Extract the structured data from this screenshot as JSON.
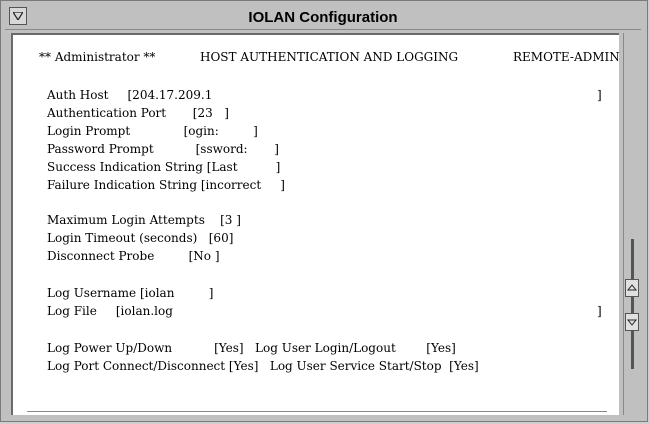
{
  "window": {
    "title": "IOLAN Configuration"
  },
  "header": {
    "left": "** Administrator **",
    "center": "HOST AUTHENTICATION AND LOGGING",
    "right": "REMOTE-ADMIN"
  },
  "fields": {
    "auth_host": "Auth Host     [204.17.209.1",
    "auth_host_end": "]",
    "auth_port": "Authentication Port       [23   ]",
    "login_prompt": "Login Prompt              [ogin:         ]",
    "password_prompt": "Password Prompt           [ssword:       ]",
    "success_string": "Success Indication String [Last          ]",
    "failure_string": "Failure Indication String [incorrect     ]",
    "max_login": "Maximum Login Attempts    [3 ]",
    "login_timeout": "Login Timeout (seconds)   [60]",
    "disconnect_probe": "Disconnect Probe         [No ]",
    "log_username": "Log Username [iolan         ]",
    "log_file": "Log File     [iolan.log",
    "log_file_end": "]",
    "log_power": "Log Power Up/Down           [Yes]   Log User Login/Logout        [Yes]",
    "log_port": "Log Port Connect/Disconnect [Yes]   Log User Service Start/Stop  [Yes]"
  }
}
